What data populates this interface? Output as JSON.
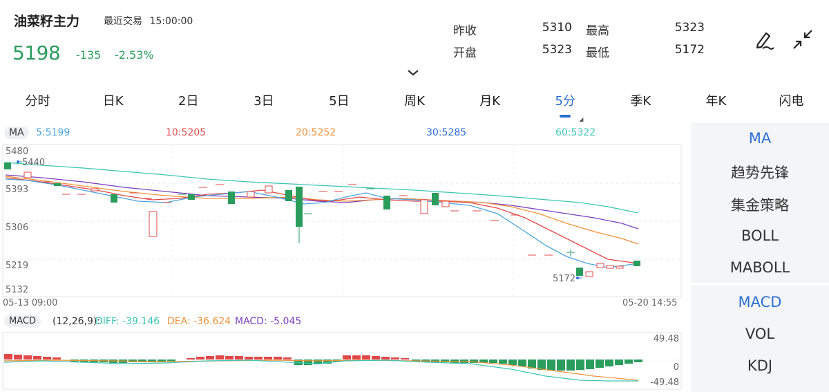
{
  "header": {
    "title": "油菜籽主力",
    "trade_label": "最近交易",
    "trade_time": "15:00:00",
    "price": "5198",
    "change": "-135",
    "change_pct": "-2.53%",
    "collapse_icon": "chevron-down-icon",
    "up_color": "#e04848",
    "down_color": "#2a9d5c"
  },
  "quote": {
    "prev_close_label": "昨收",
    "prev_close": "5310",
    "high_label": "最高",
    "high": "5323",
    "open_label": "开盘",
    "open": "5323",
    "low_label": "最低",
    "low": "5172"
  },
  "toolbar": {
    "draw_icon": "pen-icon",
    "shrink_icon": "collapse-arrows-icon"
  },
  "tabs": [
    {
      "label": "分时"
    },
    {
      "label": "日K"
    },
    {
      "label": "2日"
    },
    {
      "label": "3日"
    },
    {
      "label": "5日"
    },
    {
      "label": "周K"
    },
    {
      "label": "月K"
    },
    {
      "label": "5分",
      "active": true
    },
    {
      "label": "季K"
    },
    {
      "label": "年K"
    },
    {
      "label": "闪电"
    }
  ],
  "ma_legend": {
    "label": "MA",
    "ma5": "5:5199",
    "ma10": "10:5205",
    "ma20": "20:5252",
    "ma30": "30:5285",
    "ma60": "60:5322"
  },
  "kline": {
    "y_ticks": [
      "5480",
      "5393",
      "5306",
      "5219",
      "5132"
    ],
    "max_label": "5440",
    "min_label": "5172",
    "start_time": "05-13 09:00",
    "end_time": "05-20 14:55",
    "colors": {
      "ma5": "#4aa3df",
      "ma10": "#e04848",
      "ma20": "#f0923a",
      "ma30": "#7b3fbf",
      "ma60": "#3cc6b4"
    }
  },
  "macd_legend": {
    "label": "MACD",
    "params": "(12,26,9):",
    "diff": "DIFF: -39.146",
    "dea": "DEA: -36.624",
    "macd": "MACD: -5.045"
  },
  "macd_axis": {
    "top": "49.48",
    "zero": "0",
    "bottom": "-49.48"
  },
  "sidebar": {
    "upper": [
      "MA",
      "趋势先锋",
      "集金策略",
      "BOLL",
      "MABOLL"
    ],
    "lower": [
      "MACD",
      "VOL",
      "KDJ"
    ]
  }
}
